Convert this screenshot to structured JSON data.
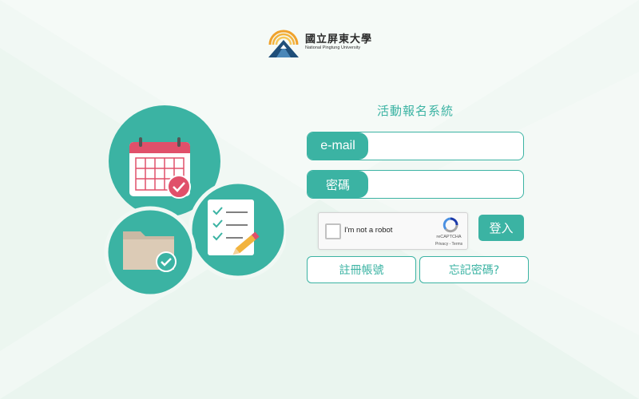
{
  "logo": {
    "name_cn": "國立屏東大學",
    "name_en": "National Pingtung University"
  },
  "system_title": "活動報名系統",
  "form": {
    "email_label": "e-mail",
    "email_value": "",
    "password_label": "密碼",
    "password_value": ""
  },
  "captcha": {
    "checkbox_label": "I'm not a robot",
    "brand": "reCAPTCHA",
    "links": "Privacy - Terms"
  },
  "buttons": {
    "login": "登入",
    "register": "註冊帳號",
    "forgot": "忘記密碼?"
  },
  "colors": {
    "accent": "#3bb3a3",
    "calendar_red": "#e0506a",
    "background": "#f1f8f4"
  },
  "icons": [
    "calendar-check-icon",
    "checklist-pencil-icon",
    "folder-check-icon",
    "recaptcha-icon"
  ]
}
